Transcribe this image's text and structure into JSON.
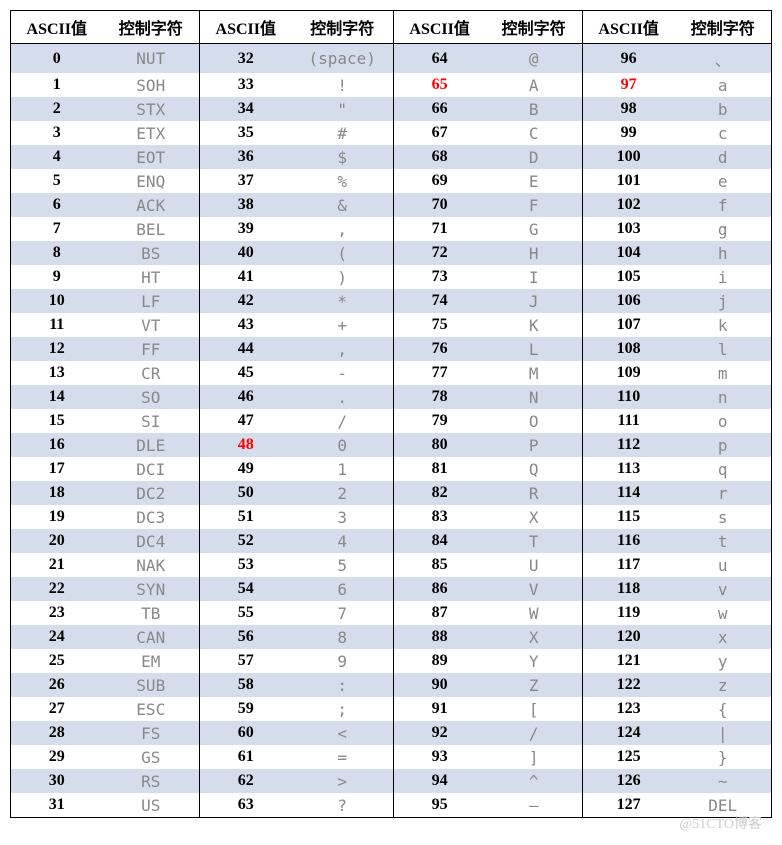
{
  "chart_data": {
    "type": "table",
    "title": "ASCII",
    "headers": [
      "ASCII值",
      "控制字符",
      "ASCII值",
      "控制字符",
      "ASCII值",
      "控制字符",
      "ASCII值",
      "控制字符"
    ],
    "highlighted_ascii_values": [
      48,
      65,
      97
    ],
    "rows": [
      {
        "c0v": "0",
        "c0c": "NUT",
        "c1v": "32",
        "c1c": "(space)",
        "c2v": "64",
        "c2c": "@",
        "c3v": "96",
        "c3c": "、"
      },
      {
        "c0v": "1",
        "c0c": "SOH",
        "c1v": "33",
        "c1c": "!",
        "c2v": "65",
        "c2c": "A",
        "c3v": "97",
        "c3c": "a"
      },
      {
        "c0v": "2",
        "c0c": "STX",
        "c1v": "34",
        "c1c": "\"",
        "c2v": "66",
        "c2c": "B",
        "c3v": "98",
        "c3c": "b"
      },
      {
        "c0v": "3",
        "c0c": "ETX",
        "c1v": "35",
        "c1c": "#",
        "c2v": "67",
        "c2c": "C",
        "c3v": "99",
        "c3c": "c"
      },
      {
        "c0v": "4",
        "c0c": "EOT",
        "c1v": "36",
        "c1c": "$",
        "c2v": "68",
        "c2c": "D",
        "c3v": "100",
        "c3c": "d"
      },
      {
        "c0v": "5",
        "c0c": "ENQ",
        "c1v": "37",
        "c1c": "%",
        "c2v": "69",
        "c2c": "E",
        "c3v": "101",
        "c3c": "e"
      },
      {
        "c0v": "6",
        "c0c": "ACK",
        "c1v": "38",
        "c1c": "&",
        "c2v": "70",
        "c2c": "F",
        "c3v": "102",
        "c3c": "f"
      },
      {
        "c0v": "7",
        "c0c": "BEL",
        "c1v": "39",
        "c1c": ",",
        "c2v": "71",
        "c2c": "G",
        "c3v": "103",
        "c3c": "g"
      },
      {
        "c0v": "8",
        "c0c": "BS",
        "c1v": "40",
        "c1c": "(",
        "c2v": "72",
        "c2c": "H",
        "c3v": "104",
        "c3c": "h"
      },
      {
        "c0v": "9",
        "c0c": "HT",
        "c1v": "41",
        "c1c": ")",
        "c2v": "73",
        "c2c": "I",
        "c3v": "105",
        "c3c": "i"
      },
      {
        "c0v": "10",
        "c0c": "LF",
        "c1v": "42",
        "c1c": "*",
        "c2v": "74",
        "c2c": "J",
        "c3v": "106",
        "c3c": "j"
      },
      {
        "c0v": "11",
        "c0c": "VT",
        "c1v": "43",
        "c1c": "+",
        "c2v": "75",
        "c2c": "K",
        "c3v": "107",
        "c3c": "k"
      },
      {
        "c0v": "12",
        "c0c": "FF",
        "c1v": "44",
        "c1c": ",",
        "c2v": "76",
        "c2c": "L",
        "c3v": "108",
        "c3c": "l"
      },
      {
        "c0v": "13",
        "c0c": "CR",
        "c1v": "45",
        "c1c": "-",
        "c2v": "77",
        "c2c": "M",
        "c3v": "109",
        "c3c": "m"
      },
      {
        "c0v": "14",
        "c0c": "SO",
        "c1v": "46",
        "c1c": ".",
        "c2v": "78",
        "c2c": "N",
        "c3v": "110",
        "c3c": "n"
      },
      {
        "c0v": "15",
        "c0c": "SI",
        "c1v": "47",
        "c1c": "/",
        "c2v": "79",
        "c2c": "O",
        "c3v": "111",
        "c3c": "o"
      },
      {
        "c0v": "16",
        "c0c": "DLE",
        "c1v": "48",
        "c1c": "0",
        "c2v": "80",
        "c2c": "P",
        "c3v": "112",
        "c3c": "p"
      },
      {
        "c0v": "17",
        "c0c": "DCI",
        "c1v": "49",
        "c1c": "1",
        "c2v": "81",
        "c2c": "Q",
        "c3v": "113",
        "c3c": "q"
      },
      {
        "c0v": "18",
        "c0c": "DC2",
        "c1v": "50",
        "c1c": "2",
        "c2v": "82",
        "c2c": "R",
        "c3v": "114",
        "c3c": "r"
      },
      {
        "c0v": "19",
        "c0c": "DC3",
        "c1v": "51",
        "c1c": "3",
        "c2v": "83",
        "c2c": "X",
        "c3v": "115",
        "c3c": "s"
      },
      {
        "c0v": "20",
        "c0c": "DC4",
        "c1v": "52",
        "c1c": "4",
        "c2v": "84",
        "c2c": "T",
        "c3v": "116",
        "c3c": "t"
      },
      {
        "c0v": "21",
        "c0c": "NAK",
        "c1v": "53",
        "c1c": "5",
        "c2v": "85",
        "c2c": "U",
        "c3v": "117",
        "c3c": "u"
      },
      {
        "c0v": "22",
        "c0c": "SYN",
        "c1v": "54",
        "c1c": "6",
        "c2v": "86",
        "c2c": "V",
        "c3v": "118",
        "c3c": "v"
      },
      {
        "c0v": "23",
        "c0c": "TB",
        "c1v": "55",
        "c1c": "7",
        "c2v": "87",
        "c2c": "W",
        "c3v": "119",
        "c3c": "w"
      },
      {
        "c0v": "24",
        "c0c": "CAN",
        "c1v": "56",
        "c1c": "8",
        "c2v": "88",
        "c2c": "X",
        "c3v": "120",
        "c3c": "x"
      },
      {
        "c0v": "25",
        "c0c": "EM",
        "c1v": "57",
        "c1c": "9",
        "c2v": "89",
        "c2c": "Y",
        "c3v": "121",
        "c3c": "y"
      },
      {
        "c0v": "26",
        "c0c": "SUB",
        "c1v": "58",
        "c1c": ":",
        "c2v": "90",
        "c2c": "Z",
        "c3v": "122",
        "c3c": "z"
      },
      {
        "c0v": "27",
        "c0c": "ESC",
        "c1v": "59",
        "c1c": ";",
        "c2v": "91",
        "c2c": "[",
        "c3v": "123",
        "c3c": "{"
      },
      {
        "c0v": "28",
        "c0c": "FS",
        "c1v": "60",
        "c1c": "<",
        "c2v": "92",
        "c2c": "/",
        "c3v": "124",
        "c3c": "|"
      },
      {
        "c0v": "29",
        "c0c": "GS",
        "c1v": "61",
        "c1c": "=",
        "c2v": "93",
        "c2c": "]",
        "c3v": "125",
        "c3c": "}"
      },
      {
        "c0v": "30",
        "c0c": "RS",
        "c1v": "62",
        "c1c": ">",
        "c2v": "94",
        "c2c": "^",
        "c3v": "126",
        "c3c": "~"
      },
      {
        "c0v": "31",
        "c0c": "US",
        "c1v": "63",
        "c1c": "?",
        "c2v": "95",
        "c2c": "—",
        "c3v": "127",
        "c3c": "DEL"
      }
    ]
  },
  "watermark": "@51CTO博客"
}
